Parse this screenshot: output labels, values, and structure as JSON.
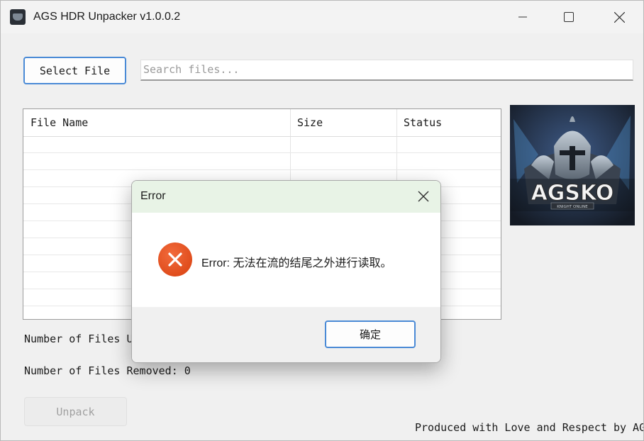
{
  "window": {
    "title": "AGS HDR Unpacker v1.0.0.2",
    "icon": "app-icon",
    "controls": [
      "minimize-icon",
      "maximize-icon",
      "close-icon"
    ]
  },
  "toolbar": {
    "select_file_label": "Select File",
    "search_placeholder": "Search files...",
    "search_value": ""
  },
  "table": {
    "columns": [
      "File Name",
      "Size",
      "Status"
    ],
    "rows": []
  },
  "banner": {
    "text": "AGSKO",
    "subtext": "KNIGHT ONLINE"
  },
  "status": {
    "files_unpacked_label": "Number of Files U",
    "files_removed_label": "Number of Files Removed: 0"
  },
  "actions": {
    "unpack_label": "Unpack"
  },
  "footer": {
    "text": "Produced with Love and Respect by AG"
  },
  "dialog": {
    "title": "Error",
    "message": "Error: 无法在流的结尾之外进行读取。",
    "ok_label": "确定",
    "icon": "error-icon",
    "accent_color": "#e8f3e6"
  },
  "colors": {
    "accent": "#4a8ad6",
    "error": "#e0481a"
  }
}
